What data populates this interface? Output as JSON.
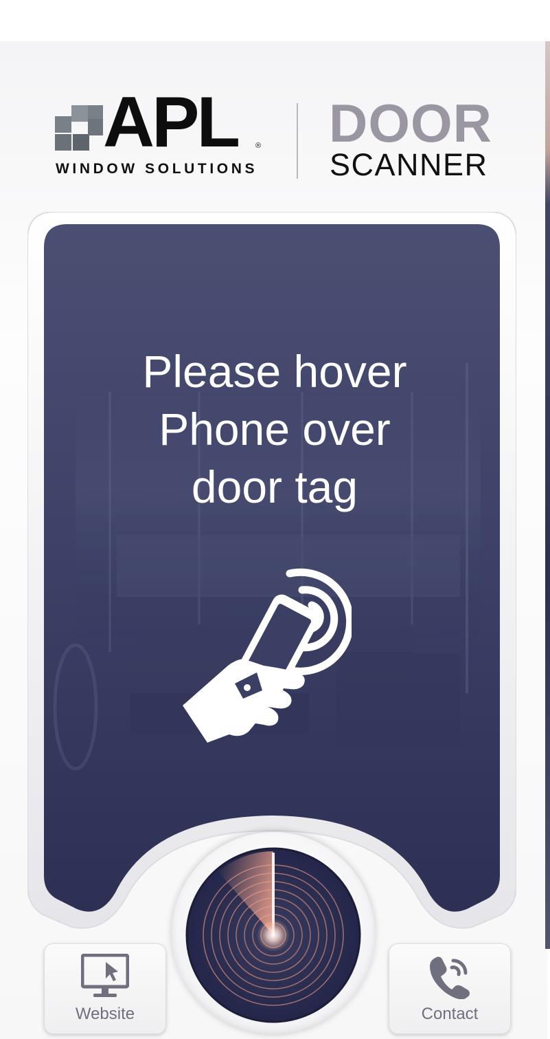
{
  "header": {
    "brand": "APL",
    "registered_mark": "®",
    "tagline": "WINDOW SOLUTIONS",
    "product_line1": "DOOR",
    "product_line2": "SCANNER"
  },
  "main": {
    "prompt_line1": "Please hover",
    "prompt_line2": "Phone over",
    "prompt_line3": "door tag"
  },
  "footer": {
    "website_label": "Website",
    "contact_label": "Contact"
  },
  "icons": {
    "hand": "hand-holding-phone-icon",
    "radar": "radar-scan-icon",
    "website": "monitor-cursor-icon",
    "contact": "phone-call-icon"
  },
  "colors": {
    "card_background": "#3a3e62",
    "brand_grey": "#9a97a3",
    "radar_background": "#2b2e4c",
    "radar_accent": "#e9a48f",
    "button_label": "#6f6f7d"
  }
}
